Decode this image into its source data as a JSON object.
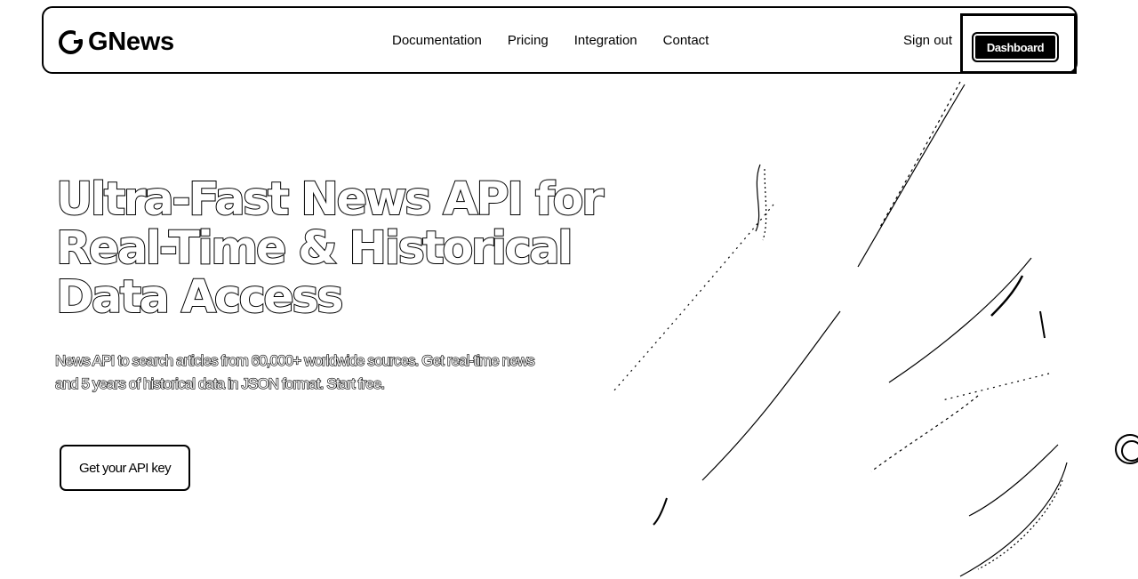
{
  "brand": {
    "name": "GNews",
    "icon": "g-logo-icon"
  },
  "nav": {
    "links": [
      "Documentation",
      "Pricing",
      "Integration",
      "Contact"
    ],
    "sign_in": "Sign out",
    "dashboard": "Dashboard"
  },
  "hero": {
    "title_lines": [
      "Ultra-Fast News API for",
      "Real-Time & Historical",
      "Data Access"
    ],
    "subtitle": "News API to search articles from 60,000+ worldwide sources. Get real-time news and 5 years of historical data in JSON format. Start free.",
    "cta": "Get your API key"
  },
  "colors": {
    "ink": "#000000",
    "background": "#ffffff"
  }
}
